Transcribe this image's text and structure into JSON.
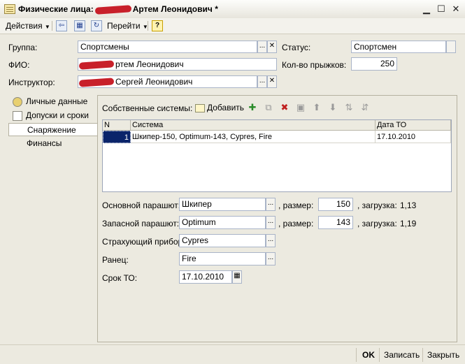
{
  "window": {
    "title_prefix": "Физические лица:",
    "title_suffix": "Артем Леонидович *",
    "minimize": "▁",
    "maximize": "☐",
    "close": "✕"
  },
  "toolbar": {
    "actions_label": "Действия",
    "goto_label": "Перейти",
    "help_label": "?"
  },
  "form": {
    "group_label": "Группа:",
    "group_value": "Спортсмены",
    "status_label": "Статус:",
    "status_value": "Спортсмен",
    "fio_label": "ФИО:",
    "fio_value": "ртем Леонидович",
    "jumps_label": "Кол-во прыжков:",
    "jumps_value": "250",
    "instructor_label": "Инструктор:",
    "instructor_value": "Сергей Леонидович",
    "select_btn": "...",
    "clear_btn": "✕"
  },
  "tabs": [
    {
      "label": "Личные данные"
    },
    {
      "label": "Допуски и сроки"
    },
    {
      "label": "Снаряжение"
    },
    {
      "label": "Финансы"
    }
  ],
  "equipment": {
    "own_systems_label": "Собственные системы:",
    "add_label": "Добавить",
    "table": {
      "columns": [
        "N",
        "Система",
        "Дата ТО"
      ],
      "rows": [
        {
          "n": "1",
          "system": "Шкипер-150, Optimum-143, Cypres, Fire",
          "date": "17.10.2010"
        }
      ]
    },
    "main_chute_label": "Основной парашют:",
    "main_chute_value": "Шкипер",
    "main_size_label": ", размер:",
    "main_size_value": "150",
    "main_load_label": ", загрузка:",
    "main_load_value": "1,13",
    "reserve_label": "Запасной парашют:",
    "reserve_value": "Optimum",
    "reserve_size_label": ", размер:",
    "reserve_size_value": "143",
    "reserve_load_label": ", загрузка:",
    "reserve_load_value": "1,19",
    "aad_label": "Страхующий прибор:",
    "aad_value": "Cypres",
    "container_label": "Ранец:",
    "container_value": "Fire",
    "service_label": "Срок ТО:",
    "service_value": "17.10.2010"
  },
  "buttons": {
    "ok": "OK",
    "save": "Записать",
    "close": "Закрыть"
  }
}
